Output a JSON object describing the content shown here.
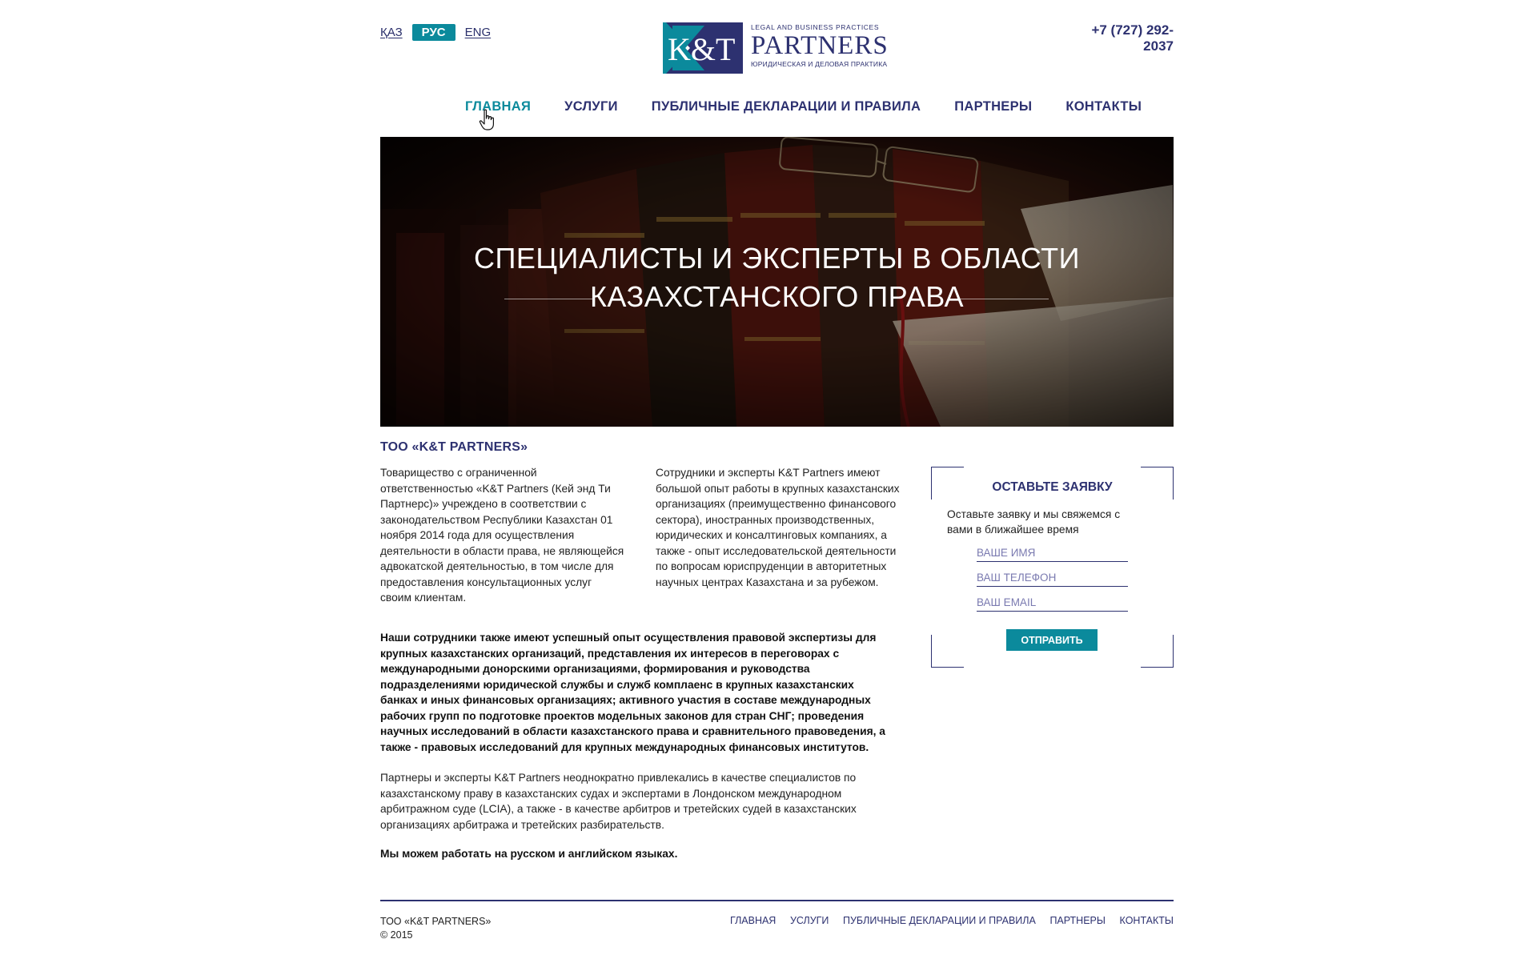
{
  "header": {
    "languages": [
      {
        "label": "ҚАЗ",
        "active": false
      },
      {
        "label": "РУС",
        "active": true
      },
      {
        "label": "ENG",
        "active": false
      }
    ],
    "phone": "+7 (727) 292-2037",
    "logo": {
      "mark": "K&T",
      "tagline_top": "LEGAL AND BUSINESS PRACTICES",
      "name": "PARTNERS",
      "tagline_bottom": "ЮРИДИЧЕСКАЯ И ДЕЛОВАЯ ПРАКТИКА"
    }
  },
  "nav": {
    "items": [
      {
        "label": "ГЛАВНАЯ",
        "current": true
      },
      {
        "label": "УСЛУГИ",
        "current": false
      },
      {
        "label": "ПУБЛИЧНЫЕ ДЕКЛАРАЦИИ И ПРАВИЛА",
        "current": false
      },
      {
        "label": "ПАРТНЕРЫ",
        "current": false
      },
      {
        "label": "КОНТАКТЫ",
        "current": false
      }
    ]
  },
  "hero": {
    "line1": "СПЕЦИАЛИСТЫ И ЭКСПЕРТЫ В ОБЛАСТИ",
    "line2": "КАЗАХСТАНСКОГО ПРАВА"
  },
  "content": {
    "company_title": "ТОО «K&T PARTNERS»",
    "col1": "Товарищество с ограниченной ответственностью «K&T Partners (Кей энд Ти Партнерс)» учреждено в соответствии с законодательством Республики Казахстан 01 ноября 2014 года для осуществления деятельности в области права, не являющейся адвокатской деятельностью, в том числе для предоставления консультационных услуг своим клиентам.",
    "col2": "Сотрудники и эксперты K&T Partners имеют большой опыт работы в крупных казахстанских организациях (преимущественно финансового сектора), иностранных производственных, юридических и консалтинговых компаниях, а также - опыт исследовательской деятельности по вопросам юриспруденции в авторитетных научных центрах Казахстана и за рубежом.",
    "bold_para": "Наши сотрудники также имеют успешный опыт осуществления правовой экспертизы для крупных казахстанских организаций, представления их интересов в переговорах с международными донорскими организациями, формирования и руководства подразделениями юридической службы и служб комплаенс в крупных казахстанских банках и иных финансовых организациях; активного участия в составе международных рабочих групп по подготовке проектов модельных законов для стран СНГ; проведения научных исследований в области казахстанского права и сравнительного правоведения, а также - правовых исследований для крупных международных финансовых институтов.",
    "para3": "Партнеры и эксперты K&T Partners неоднократно привлекались в качестве специалистов по казахстанскому праву в казахстанских судах и экспертами в Лондонском международном арбитражном суде (LCIA), а также - в качестве арбитров и третейских судей в казахстанских организациях арбитража и третейских разбирательств.",
    "para4": "Мы можем работать на русском и английском языках."
  },
  "form": {
    "title": "ОСТАВЬТЕ ЗАЯВКУ",
    "description": "Оставьте заявку и мы свяжемся с вами в ближайшее время",
    "name_placeholder": "ВАШЕ ИМЯ",
    "phone_placeholder": "ВАШ ТЕЛЕФОН",
    "email_placeholder": "ВАШ EMAIL",
    "submit_label": "ОТПРАВИТЬ"
  },
  "footer": {
    "company": "ТОО «K&T PARTNERS»",
    "copyright": "© 2015",
    "nav": [
      "ГЛАВНАЯ",
      "УСЛУГИ",
      "ПУБЛИЧНЫЕ ДЕКЛАРАЦИИ И ПРАВИЛА",
      "ПАРТНЕРЫ",
      "КОНТАКТЫ"
    ]
  },
  "colors": {
    "brand_navy": "#2d3170",
    "accent_teal": "#0b8a9c"
  }
}
